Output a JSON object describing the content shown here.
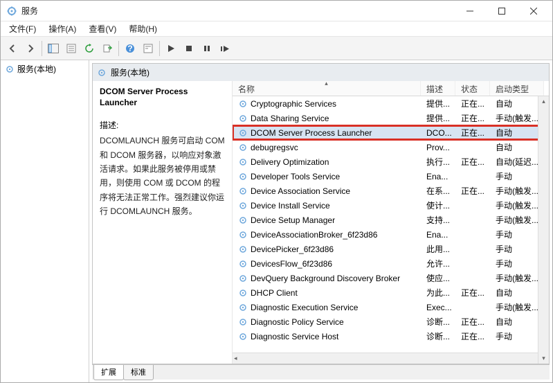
{
  "title": "服务",
  "menu": {
    "file": "文件(F)",
    "action": "操作(A)",
    "view": "查看(V)",
    "help": "帮助(H)"
  },
  "tree": {
    "root": "服务(本地)"
  },
  "paneHeader": "服务(本地)",
  "selected": {
    "name": "DCOM Server Process Launcher",
    "descLabel": "描述:",
    "desc": "DCOMLAUNCH 服务可启动 COM 和 DCOM 服务器，以响应对象激活请求。如果此服务被停用或禁用，则使用 COM 或 DCOM 的程序将无法正常工作。强烈建议你运行 DCOMLAUNCH 服务。"
  },
  "columns": {
    "name": "名称",
    "desc": "描述",
    "status": "状态",
    "startup": "启动类型"
  },
  "services": [
    {
      "name": "Cryptographic Services",
      "desc": "提供...",
      "status": "正在...",
      "startup": "自动"
    },
    {
      "name": "Data Sharing Service",
      "desc": "提供...",
      "status": "正在...",
      "startup": "手动(触发..."
    },
    {
      "name": "DCOM Server Process Launcher",
      "desc": "DCO...",
      "status": "正在...",
      "startup": "自动"
    },
    {
      "name": "debugregsvc",
      "desc": "Prov...",
      "status": "",
      "startup": "自动"
    },
    {
      "name": "Delivery Optimization",
      "desc": "执行...",
      "status": "正在...",
      "startup": "自动(延迟..."
    },
    {
      "name": "Developer Tools Service",
      "desc": "Ena...",
      "status": "",
      "startup": "手动"
    },
    {
      "name": "Device Association Service",
      "desc": "在系...",
      "status": "正在...",
      "startup": "手动(触发..."
    },
    {
      "name": "Device Install Service",
      "desc": "使计...",
      "status": "",
      "startup": "手动(触发..."
    },
    {
      "name": "Device Setup Manager",
      "desc": "支持...",
      "status": "",
      "startup": "手动(触发..."
    },
    {
      "name": "DeviceAssociationBroker_6f23d86",
      "desc": "Ena...",
      "status": "",
      "startup": "手动"
    },
    {
      "name": "DevicePicker_6f23d86",
      "desc": "此用...",
      "status": "",
      "startup": "手动"
    },
    {
      "name": "DevicesFlow_6f23d86",
      "desc": "允许...",
      "status": "",
      "startup": "手动"
    },
    {
      "name": "DevQuery Background Discovery Broker",
      "desc": "使应...",
      "status": "",
      "startup": "手动(触发..."
    },
    {
      "name": "DHCP Client",
      "desc": "为此...",
      "status": "正在...",
      "startup": "自动"
    },
    {
      "name": "Diagnostic Execution Service",
      "desc": "Exec...",
      "status": "",
      "startup": "手动(触发..."
    },
    {
      "name": "Diagnostic Policy Service",
      "desc": "诊断...",
      "status": "正在...",
      "startup": "自动"
    },
    {
      "name": "Diagnostic Service Host",
      "desc": "诊断...",
      "status": "正在...",
      "startup": "手动"
    }
  ],
  "highlightIndex": 2,
  "tabs": {
    "extended": "扩展",
    "standard": "标准"
  }
}
